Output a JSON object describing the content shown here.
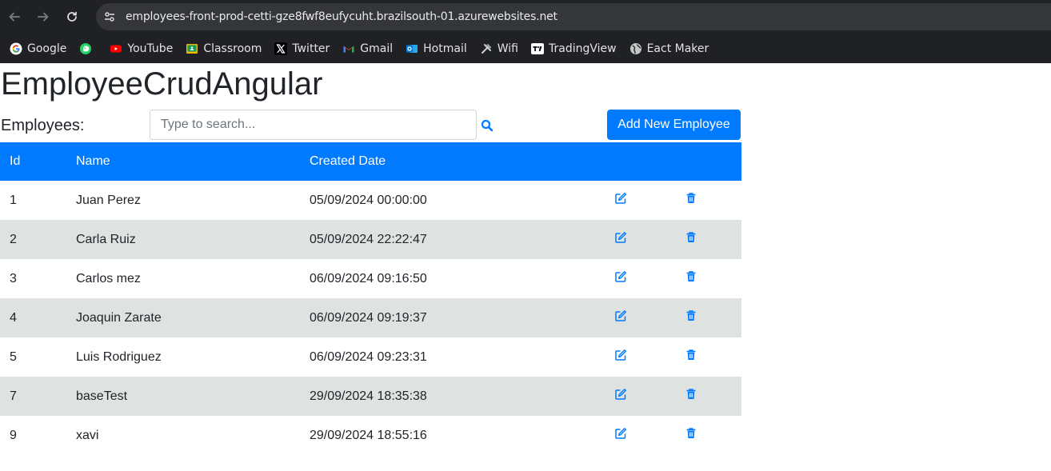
{
  "browser": {
    "url": "employees-front-prod-cetti-gze8fwf8eufycuht.brazilsouth-01.azurewebsites.net",
    "bookmarks": [
      {
        "label": "Google",
        "icon": "google-icon"
      },
      {
        "label": "",
        "icon": "whatsapp-icon"
      },
      {
        "label": "YouTube",
        "icon": "youtube-icon"
      },
      {
        "label": "Classroom",
        "icon": "classroom-icon"
      },
      {
        "label": "Twitter",
        "icon": "x-twitter-icon"
      },
      {
        "label": "Gmail",
        "icon": "gmail-icon"
      },
      {
        "label": "Hotmail",
        "icon": "outlook-icon"
      },
      {
        "label": "Wifi",
        "icon": "tools-icon"
      },
      {
        "label": "TradingView",
        "icon": "tradingview-icon"
      },
      {
        "label": "Eact Maker",
        "icon": "globe-icon"
      }
    ]
  },
  "app": {
    "title": "EmployeeCrudAngular",
    "employees_label": "Employees:",
    "search": {
      "placeholder": "Type to search...",
      "value": ""
    },
    "add_button_label": "Add New Employee"
  },
  "table": {
    "columns": [
      "Id",
      "Name",
      "Created Date",
      "",
      ""
    ],
    "rows": [
      {
        "id": "1",
        "name": "Juan Perez",
        "created": "05/09/2024 00:00:00"
      },
      {
        "id": "2",
        "name": "Carla Ruiz",
        "created": "05/09/2024 22:22:47"
      },
      {
        "id": "3",
        "name": "Carlos mez",
        "created": "06/09/2024 09:16:50"
      },
      {
        "id": "4",
        "name": "Joaquin Zarate",
        "created": "06/09/2024 09:19:37"
      },
      {
        "id": "5",
        "name": "Luis Rodriguez",
        "created": "06/09/2024 09:23:31"
      },
      {
        "id": "7",
        "name": "baseTest",
        "created": "29/09/2024 18:35:38"
      },
      {
        "id": "9",
        "name": "xavi",
        "created": "29/09/2024 18:55:16"
      }
    ]
  },
  "colors": {
    "primary": "#007bff",
    "row_stripe": "#dee2e1",
    "chrome_bg": "#202124"
  }
}
